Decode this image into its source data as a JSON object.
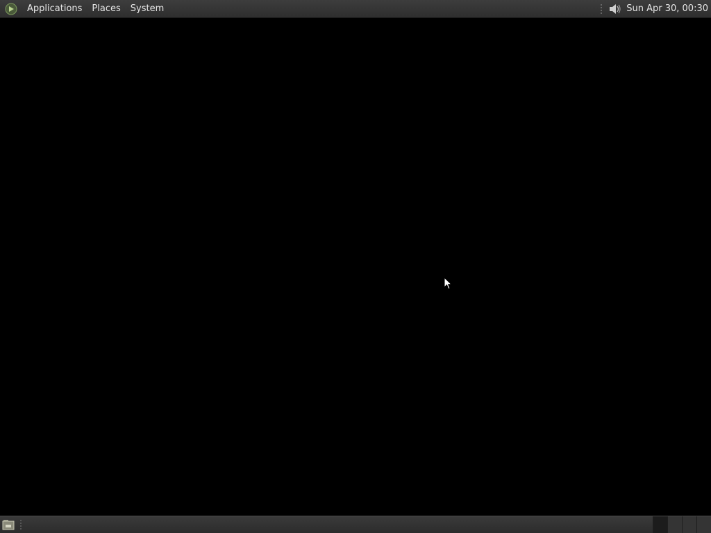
{
  "top_panel": {
    "menus": [
      {
        "label": "Applications"
      },
      {
        "label": "Places"
      },
      {
        "label": "System"
      }
    ],
    "clock": "Sun Apr 30, 00:30",
    "logo_icon": "mint-logo-icon",
    "volume_icon": "speaker-volume-icon"
  },
  "bottom_panel": {
    "show_desktop_icon": "show-desktop-icon",
    "workspaces": [
      {
        "name": "workspace-1",
        "active": true
      },
      {
        "name": "workspace-2",
        "active": false
      },
      {
        "name": "workspace-3",
        "active": false
      },
      {
        "name": "workspace-4",
        "active": false
      }
    ]
  },
  "colors": {
    "desktop_background": "#000000",
    "panel": "#333333",
    "panel_text": "#e6e6e6"
  }
}
